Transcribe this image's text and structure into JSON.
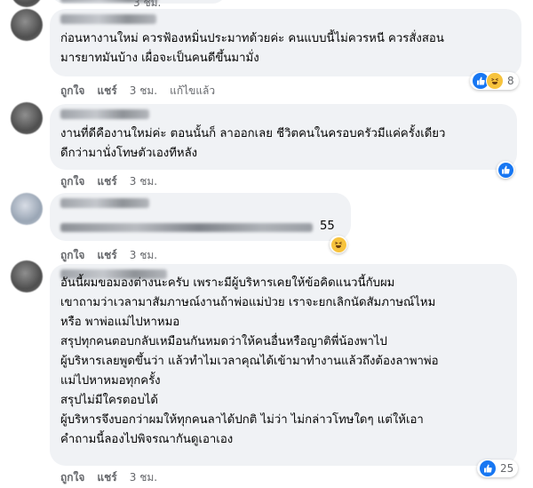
{
  "actions": {
    "like": "ถูกใจ",
    "share": "แชร์",
    "edited": "แก้ไขแล้ว"
  },
  "top_clip": {
    "time": "3 ชม."
  },
  "comments": [
    {
      "lines": [
        "ก่อนหางานใหม่ ควรฟ้องหมิ่นประมาทด้วยค่ะ คนแบบนี้ไม่ควรหนี ควรสั่งสอน",
        "มารยาทมันบ้าง เผื่อจะเป็นคนดีขึ้นมามั่ง"
      ],
      "time": "3 ชม.",
      "edited": true,
      "reactions": {
        "types": [
          "like-icon",
          "haha-icon"
        ],
        "count": "8"
      }
    },
    {
      "lines": [
        "งานที่ดีคืองานใหม่ค่ะ ตอนนั้นก็ ลาออกเลย ชีวิตคนในครอบครัวมีแค่ครั้งเดียว",
        "ดีกว่ามานั่งโทษตัวเองทีหลัง"
      ],
      "time": "3 ชม.",
      "edited": false,
      "reactions": {
        "types": [
          "like-icon"
        ],
        "count": ""
      }
    },
    {
      "suffix": "55",
      "time": "3 ชม.",
      "edited": false,
      "reactions": {
        "types": [
          "haha-icon"
        ],
        "count": ""
      }
    },
    {
      "lines": [
        "อันนี้ผมขอมองต่างนะครับ เพราะมีผู้บริหารเคยให้ข้อคิดแนวนี้กับผม",
        "เขาถามว่าเวลามาสัมภาษณ์งานถ้าพ่อแม่ป่วย เราจะยกเลิกนัดสัมภาษณ์ไหม",
        "หรือ พาพ่อแม่ไปหาหมอ",
        "สรุปทุกคนตอบกลับเหมือนกันหมดว่าให้คนอื่นหรือญาติพี่น้องพาไป",
        "ผู้บริหารเลยพูดขึ้นว่า แล้วทำไมเวลาคุณได้เข้ามาทำงานแล้วถึงต้องลาพาพ่อ",
        "แม่ไปหาหมอทุกครั้ง",
        "สรุปไม่มีใครตอบได้",
        "ผู้บริหารจึงบอกว่าผมให้ทุกคนลาได้ปกติ ไม่ว่า ไม่กล่าวโทษใดๆ แต่ให้เอา",
        "คำถามนี้ลองไปพิจรณากันดูเอาเอง"
      ],
      "time": "3 ชม.",
      "edited": false,
      "reactions": {
        "types": [
          "like-icon"
        ],
        "count": "25"
      }
    }
  ]
}
